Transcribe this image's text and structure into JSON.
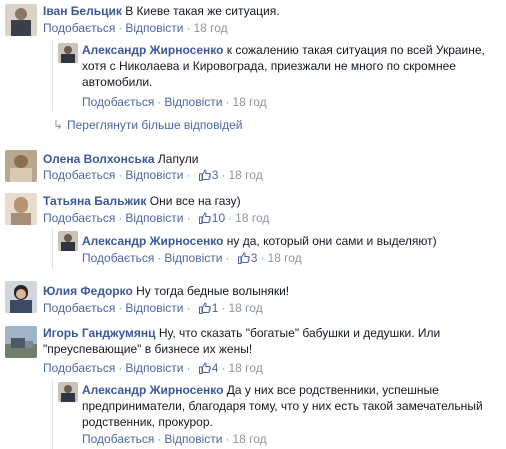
{
  "actions": {
    "like": "Подобається",
    "reply": "Відповісти"
  },
  "comments": [
    {
      "name": "Іван Бельцик",
      "text": "В Киеве такая же ситуация.",
      "time": "18 год"
    },
    {
      "name": "Александр Жирносенко",
      "text": "к сожалению такая ситуация по всей Украине, хотя с Николаева и Кировограда, приезжали не много по скромнее автомобили.",
      "time": "18 год"
    },
    {
      "name": "Олена Волхонська",
      "text": "Лапули",
      "likes": "3",
      "time": "18 год"
    },
    {
      "name": "Татьяна Бальжик",
      "text": "Они все на газу)",
      "likes": "10",
      "time": "18 год"
    },
    {
      "name": "Александр Жирносенко",
      "text": "ну да, который они сами и выделяют)",
      "likes": "3",
      "time": "18 год"
    },
    {
      "name": "Юлия Федорко",
      "text": "Ну тогда бедные волыняки!",
      "likes": "1",
      "time": "18 год"
    },
    {
      "name": "Игорь Ганджумянц",
      "text": "Ну, что сказать \"богатые\" бабушки и дедушки. Или \"преуспевающие\" в бизнесе их жены!",
      "likes": "4",
      "time": "18 год"
    },
    {
      "name": "Александр Жирносенко",
      "text": "Да у них все родственники, успешные предприниматели, благодаря тому, что у них есть такой замечательный родственник, прокурор.",
      "time": "18 год"
    }
  ],
  "more_replies": "Переглянути більше відповідей",
  "colors": {
    "link": "#3b5998",
    "meta": "#90949c",
    "action": "#4b67a1"
  }
}
